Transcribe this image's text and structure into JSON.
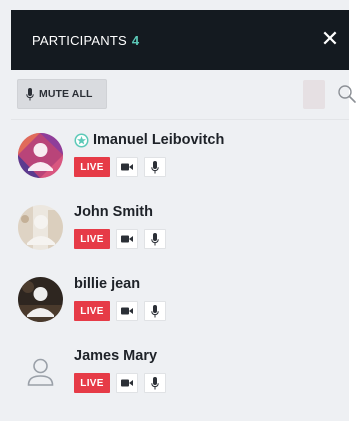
{
  "header": {
    "title": "PARTICIPANTS",
    "count": "4",
    "close_icon": "close-icon"
  },
  "toolbar": {
    "mute_all_label": "MUTE ALL",
    "mute_icon": "microphone-icon",
    "search_icon": "search-icon"
  },
  "colors": {
    "header_bg": "#141a20",
    "count_accent": "#5cc9b8",
    "live_badge": "#e63b47",
    "panel_bg": "#eef0f3"
  },
  "participants": [
    {
      "name": "Imanuel Leibovitch",
      "is_host": true,
      "host_icon": "host-star-icon",
      "status": "LIVE",
      "avatar": "colorful-avatar"
    },
    {
      "name": "John Smith",
      "is_host": false,
      "status": "LIVE",
      "avatar": "photo-avatar"
    },
    {
      "name": "billie jean",
      "is_host": false,
      "status": "LIVE",
      "avatar": "photo-avatar"
    },
    {
      "name": "James Mary",
      "is_host": false,
      "status": "LIVE",
      "avatar": "default-avatar"
    }
  ]
}
